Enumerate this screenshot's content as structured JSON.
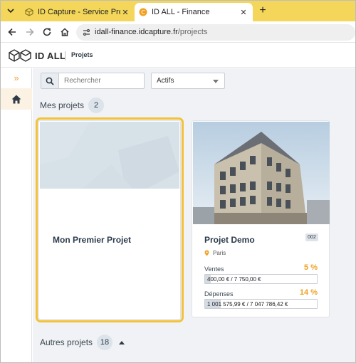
{
  "browser": {
    "tabs": [
      {
        "title": "ID Capture - Service Production",
        "active": false
      },
      {
        "title": "ID ALL - Finance",
        "active": true
      }
    ],
    "new_tab": "+",
    "close_glyph": "✕",
    "url_host": "idall-finance.idcapture.fr",
    "url_path": "/projects"
  },
  "app": {
    "logo_text": "ID ALL",
    "breadcrumb": "Projets"
  },
  "sidebar": {
    "expand_glyph": "»",
    "items": [
      {
        "name": "home-icon",
        "active": true
      }
    ]
  },
  "toolbar": {
    "search_placeholder": "Rechercher",
    "filter_value": "Actifs"
  },
  "my_projects": {
    "title": "Mes projets",
    "count": "2",
    "cards": [
      {
        "title": "Mon Premier Projet"
      },
      {
        "title": "Projet Demo",
        "badge": "002",
        "location": "Paris",
        "sales_label": "Ventes",
        "sales_pct": "5 %",
        "sales_progress": 0.05,
        "sales_text": "400,00 € / 7 750,00 €",
        "expenses_label": "Dépenses",
        "expenses_pct": "14 %",
        "expenses_progress": 0.14,
        "expenses_text": "1 001 575,99 € / 7 047 786,42 €"
      }
    ]
  },
  "other_projects": {
    "title": "Autres projets",
    "count": "18"
  },
  "colors": {
    "accent": "#f2c23a",
    "percent": "#f0a020",
    "tabstrip": "#f3d65a"
  }
}
